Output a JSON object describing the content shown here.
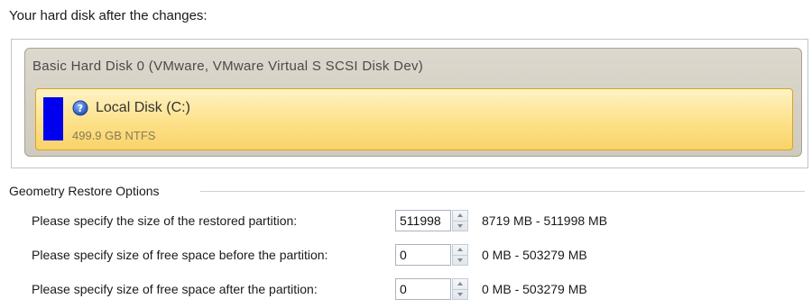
{
  "header": {
    "label": "Your hard disk after the changes:"
  },
  "disk": {
    "title": "Basic Hard Disk 0 (VMware, VMware Virtual S SCSI Disk Dev)",
    "partition": {
      "name": "Local Disk (C:)",
      "info": "499.9 GB NTFS",
      "color": "#0000ee",
      "icon": "help-question-icon"
    }
  },
  "geometry": {
    "group_label": "Geometry Restore Options",
    "options": [
      {
        "label": "Please specify the size of the restored partition:",
        "value": "511998",
        "range": "8719 MB - 511998 MB"
      },
      {
        "label": "Please specify size of free space before the partition:",
        "value": "0",
        "range": "0 MB - 503279 MB"
      },
      {
        "label": "Please specify size of free space after the partition:",
        "value": "0",
        "range": "0 MB - 503279 MB"
      }
    ]
  }
}
